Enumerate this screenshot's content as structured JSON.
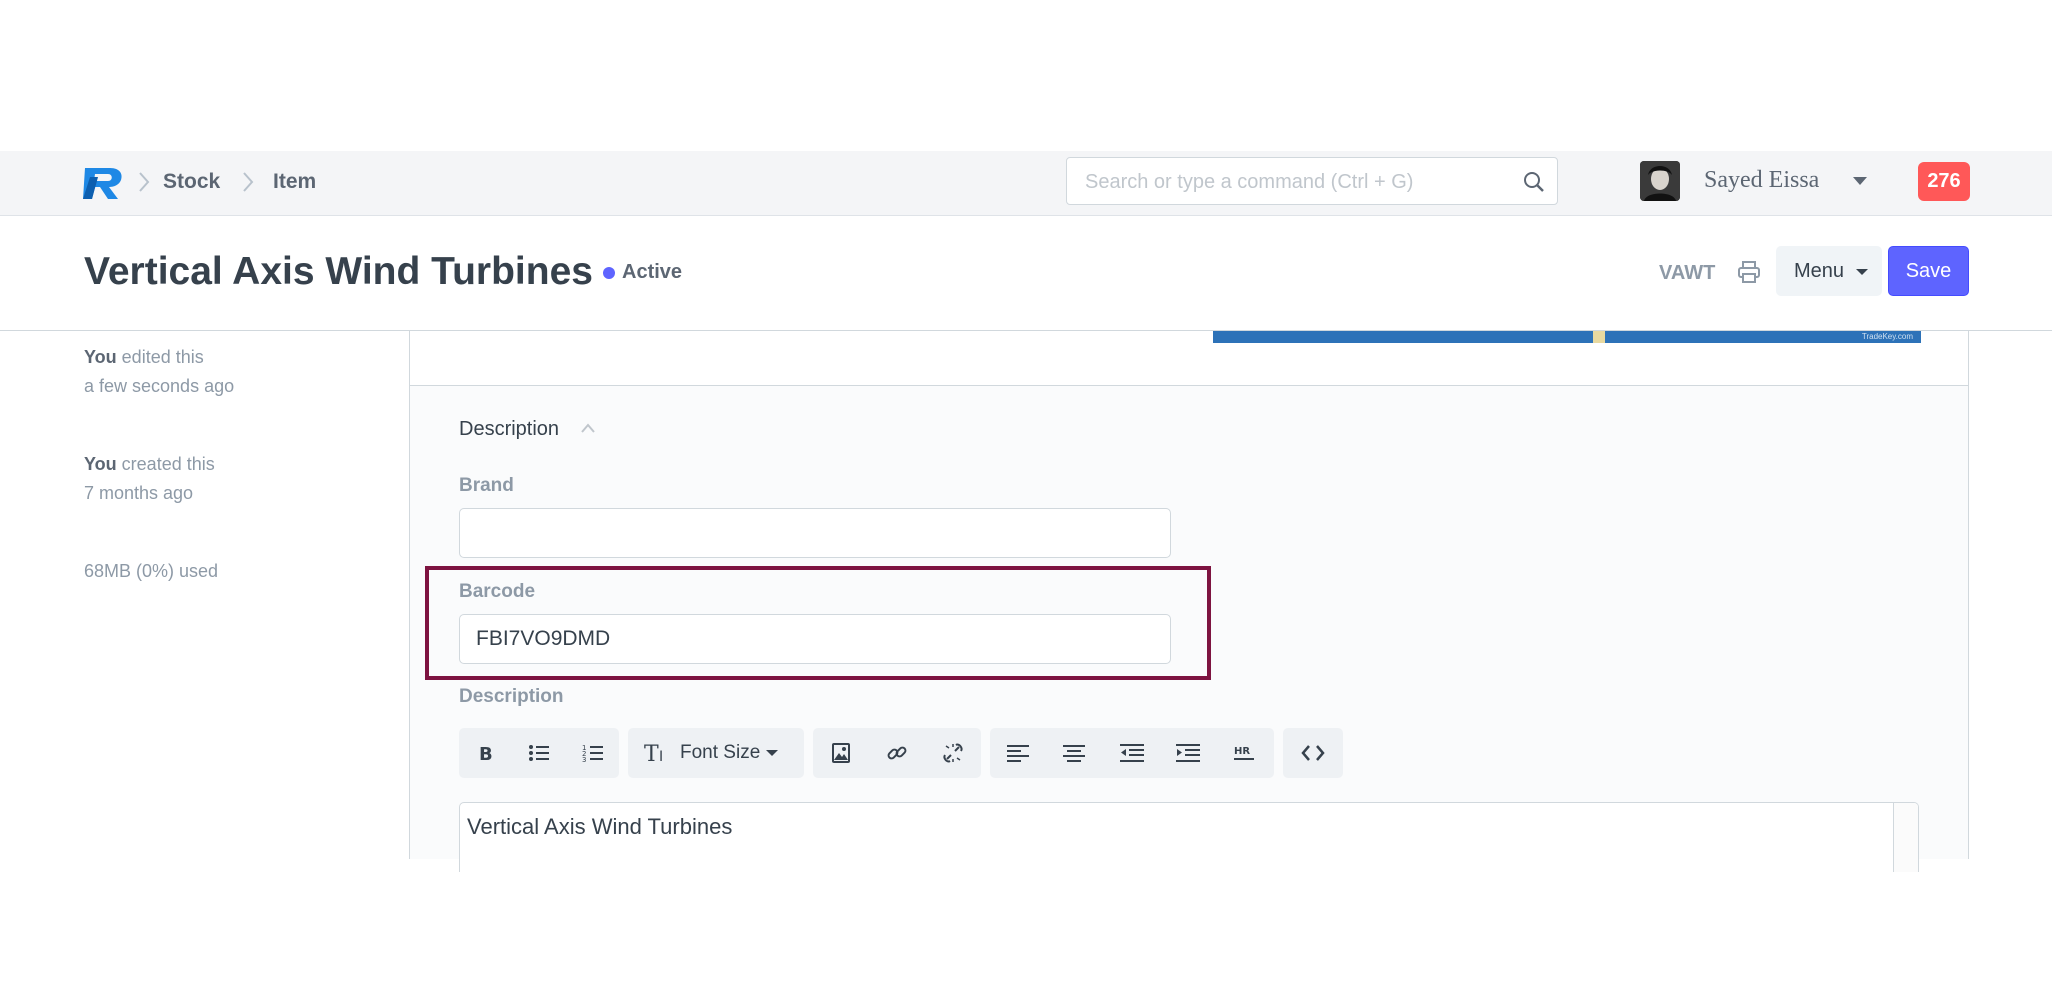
{
  "navbar": {
    "logo": "R",
    "breadcrumbs": [
      "Stock",
      "Item"
    ],
    "search_placeholder": "Search or type a command (Ctrl + G)",
    "user_name": "Sayed Eissa",
    "notification_count": "276"
  },
  "page_head": {
    "title": "Vertical Axis Wind Turbines",
    "status": "Active",
    "status_color": "#5e64ff",
    "item_code": "VAWT",
    "menu_label": "Menu",
    "save_label": "Save",
    "primary_color": "#5e64ff"
  },
  "sidebar": {
    "edited_who": "You",
    "edited_action": " edited this",
    "edited_when": "a few seconds ago",
    "created_who": "You",
    "created_action": " created this",
    "created_when": "7 months ago",
    "storage": "68MB (0%) used"
  },
  "image_watermark": "TradeKey.com",
  "form": {
    "section_title": "Description",
    "brand_label": "Brand",
    "brand_value": "",
    "barcode_label": "Barcode",
    "barcode_value": "FBI7VO9DMD",
    "description_label": "Description",
    "highlight_color": "#7d1340",
    "toolbar": {
      "font_size_label": "Font Size",
      "icons": [
        "bold-icon",
        "bullet-list-icon",
        "numbered-list-icon",
        "font-size-icon",
        "image-icon",
        "link-icon",
        "unlink-icon",
        "align-left-icon",
        "align-center-icon",
        "outdent-icon",
        "indent-icon",
        "horizontal-rule-icon",
        "code-view-icon"
      ]
    },
    "description_text": "Vertical Axis Wind Turbines"
  }
}
